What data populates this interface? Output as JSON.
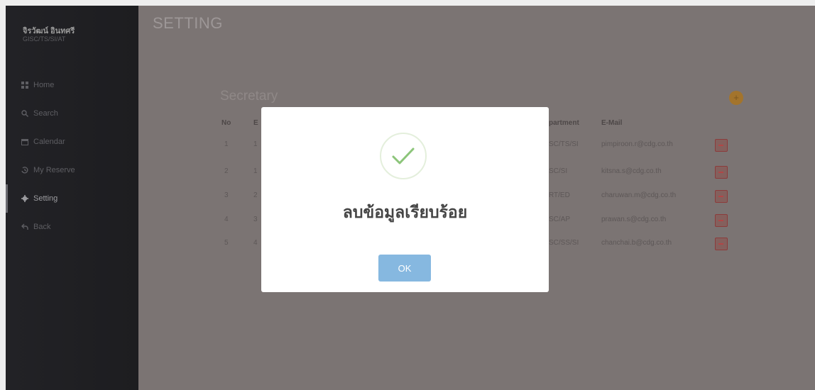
{
  "sidebar": {
    "user_name": "จิรวัฒน์ อินทศรี",
    "user_dept": "GISC/TS/SI/AT",
    "items": [
      {
        "label": "Home",
        "icon": "grid-icon",
        "active": false
      },
      {
        "label": "Search",
        "icon": "search-icon",
        "active": false
      },
      {
        "label": "Calendar",
        "icon": "calendar-icon",
        "active": false
      },
      {
        "label": "My Reserve",
        "icon": "history-icon",
        "active": false
      },
      {
        "label": "Setting",
        "icon": "gear-icon",
        "active": true
      },
      {
        "label": "Back",
        "icon": "back-arrow-icon",
        "active": false
      }
    ]
  },
  "main": {
    "page_title": "SETTING",
    "section_title": "Secretary",
    "add_badge": "+",
    "table": {
      "headers": {
        "no": "No",
        "col2": "E",
        "department": "partment",
        "email": "E-Mail"
      },
      "rows": [
        {
          "no": "1",
          "col2": "1",
          "department": "SC/TS/SI",
          "email": "pimpiroon.r@cdg.co.th"
        },
        {
          "no": "2",
          "col2": "1",
          "department": "SC/SI",
          "email": "kitsna.s@cdg.co.th"
        },
        {
          "no": "3",
          "col2": "2",
          "department": "RT/ED",
          "email": "charuwan.m@cdg.co.th"
        },
        {
          "no": "4",
          "col2": "3",
          "department": "SC/AP",
          "email": "prawan.s@cdg.co.th"
        },
        {
          "no": "5",
          "col2": "4",
          "department": "SC/SS/SI",
          "email": "chanchai.b@cdg.co.th"
        }
      ]
    }
  },
  "modal": {
    "message": "ลบข้อมูลเรียบร้อย",
    "ok_label": "OK"
  },
  "colors": {
    "sidebar_bg": "#1e1e21",
    "overlay_bg": "#7b7473",
    "modal_bg": "#ffffff",
    "check_green": "#8cc57a",
    "ok_button": "#86b8e0",
    "delete_red": "#b04747",
    "badge_orange": "#a3742c"
  }
}
